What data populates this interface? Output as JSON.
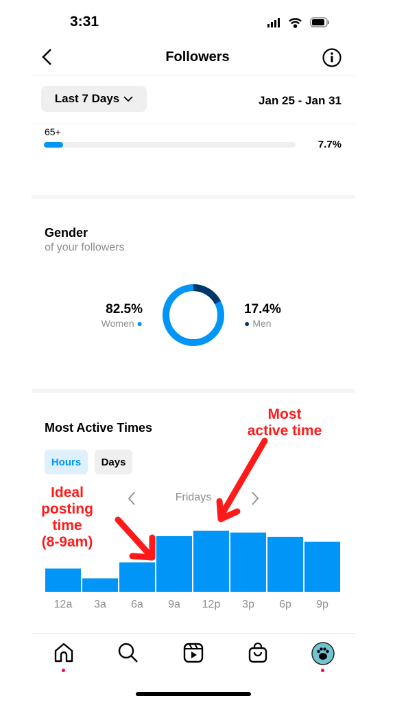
{
  "status_bar": {
    "time": "3:31"
  },
  "header": {
    "title": "Followers",
    "back_icon": "chevron-left-icon",
    "info_icon": "info-icon"
  },
  "filter": {
    "range_label": "Last 7 Days",
    "date_range": "Jan 25 - Jan 31"
  },
  "age": {
    "label": "65+",
    "percent_text": "7.7%",
    "percent": 7.7
  },
  "gender": {
    "title": "Gender",
    "subtitle": "of your followers",
    "women": {
      "percent_text": "82.5%",
      "label": "Women",
      "value": 82.5,
      "color": "#0095f6"
    },
    "men": {
      "percent_text": "17.4%",
      "label": "Men",
      "value": 17.4,
      "color": "#00376b"
    }
  },
  "active_times": {
    "title": "Most Active Times",
    "tabs": [
      {
        "label": "Hours",
        "selected": true
      },
      {
        "label": "Days",
        "selected": false
      }
    ],
    "day_label": "Fridays"
  },
  "chart_data": {
    "type": "bar",
    "categories": [
      "12a",
      "3a",
      "6a",
      "9a",
      "12p",
      "3p",
      "6p",
      "9p"
    ],
    "values": [
      38,
      22,
      48,
      91,
      100,
      97,
      90,
      82
    ],
    "color": "#0095f6",
    "grid": false
  },
  "annotations": {
    "ideal": [
      "Ideal",
      "posting",
      "time",
      "(8-9am)"
    ],
    "most": [
      "Most",
      "active time"
    ],
    "color": "#ff1a1a"
  },
  "bottom_nav": [
    "home-icon",
    "search-icon",
    "reels-icon",
    "shop-icon",
    "profile-avatar"
  ]
}
